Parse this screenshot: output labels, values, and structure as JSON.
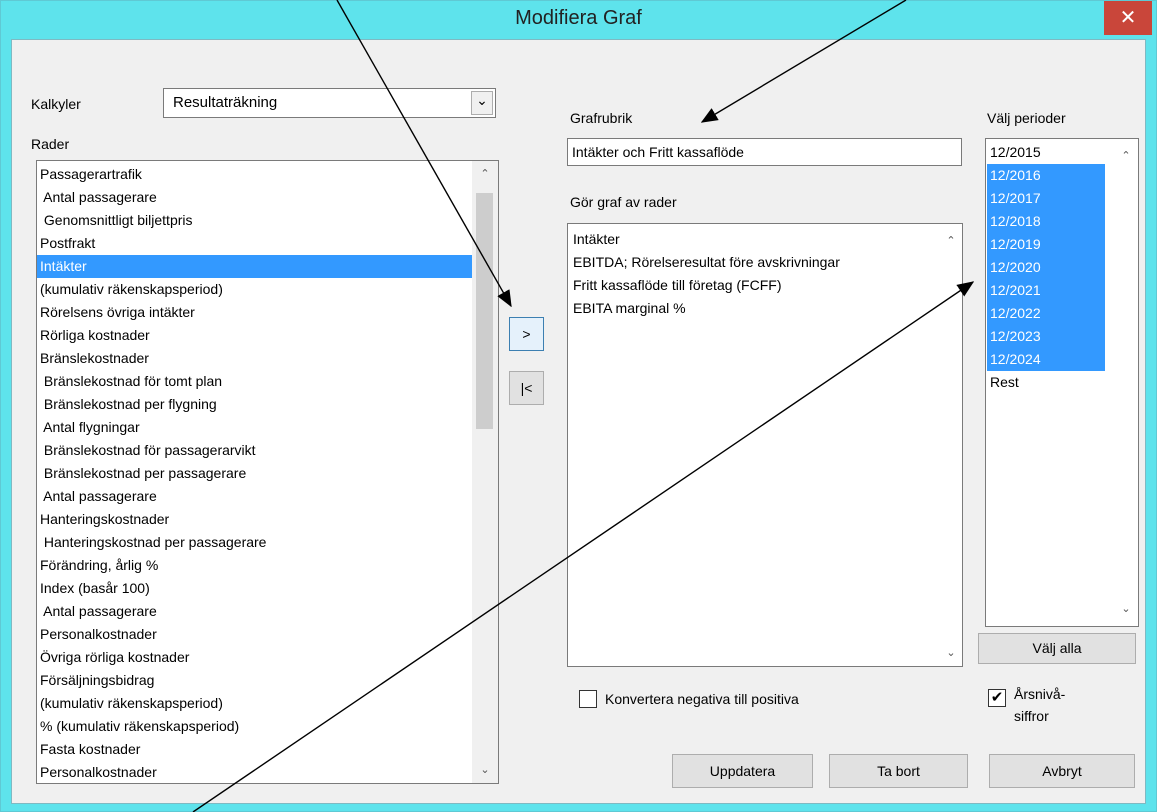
{
  "window": {
    "title": "Modifiera Graf",
    "close_glyph": "✕"
  },
  "calc": {
    "label": "Kalkyler",
    "selected": "Resultaträkning",
    "arrow": "⌄"
  },
  "rows": {
    "label": "Rader",
    "items": [
      "Passagerartrafik",
      " Antal passagerare",
      " Genomsnittligt biljettpris",
      "Postfrakt",
      "Intäkter",
      "(kumulativ räkenskapsperiod)",
      "Rörelsens övriga intäkter",
      "Rörliga kostnader",
      "Bränslekostnader",
      " Bränslekostnad för tomt plan",
      " Bränslekostnad per flygning",
      " Antal flygningar",
      " Bränslekostnad för passagerarvikt",
      " Bränslekostnad per passagerare",
      " Antal passagerare",
      "Hanteringskostnader",
      " Hanteringskostnad per passagerare",
      "Förändring, årlig %",
      "Index (basår 100)",
      " Antal passagerare",
      "Personalkostnader",
      "Övriga rörliga kostnader",
      "Försäljningsbidrag",
      "(kumulativ räkenskapsperiod)",
      "% (kumulativ räkenskapsperiod)",
      "Fasta kostnader",
      "Personalkostnader"
    ],
    "selected_index": 4
  },
  "move": {
    "add_label": ">",
    "remove_label": "|<"
  },
  "graph_title": {
    "label": "Grafrubrik",
    "value": "Intäkter och Fritt kassaflöde"
  },
  "graph_rows": {
    "label": "Gör graf av rader",
    "items": [
      "Intäkter",
      "EBITDA; Rörelseresultat före avskrivningar",
      "Fritt kassaflöde till företag (FCFF)",
      "EBITA marginal %"
    ]
  },
  "periods": {
    "label": "Välj perioder",
    "items": [
      "12/2015",
      "12/2016",
      "12/2017",
      "12/2018",
      "12/2019",
      "12/2020",
      "12/2021",
      "12/2022",
      "12/2023",
      "12/2024",
      "Rest"
    ],
    "selected": [
      false,
      true,
      true,
      true,
      true,
      true,
      true,
      true,
      true,
      true,
      false
    ],
    "select_all_label": "Välj alla"
  },
  "convert": {
    "label": "Konvertera negativa till positiva",
    "checked": false
  },
  "annual": {
    "label_line1": "Årsnivå-",
    "label_line2": "siffror",
    "checked": true,
    "check_glyph": "✔"
  },
  "buttons": {
    "update": "Uppdatera",
    "delete": "Ta bort",
    "cancel": "Avbryt"
  },
  "scroll_glyphs": {
    "up": "⌃",
    "down": "⌄"
  }
}
